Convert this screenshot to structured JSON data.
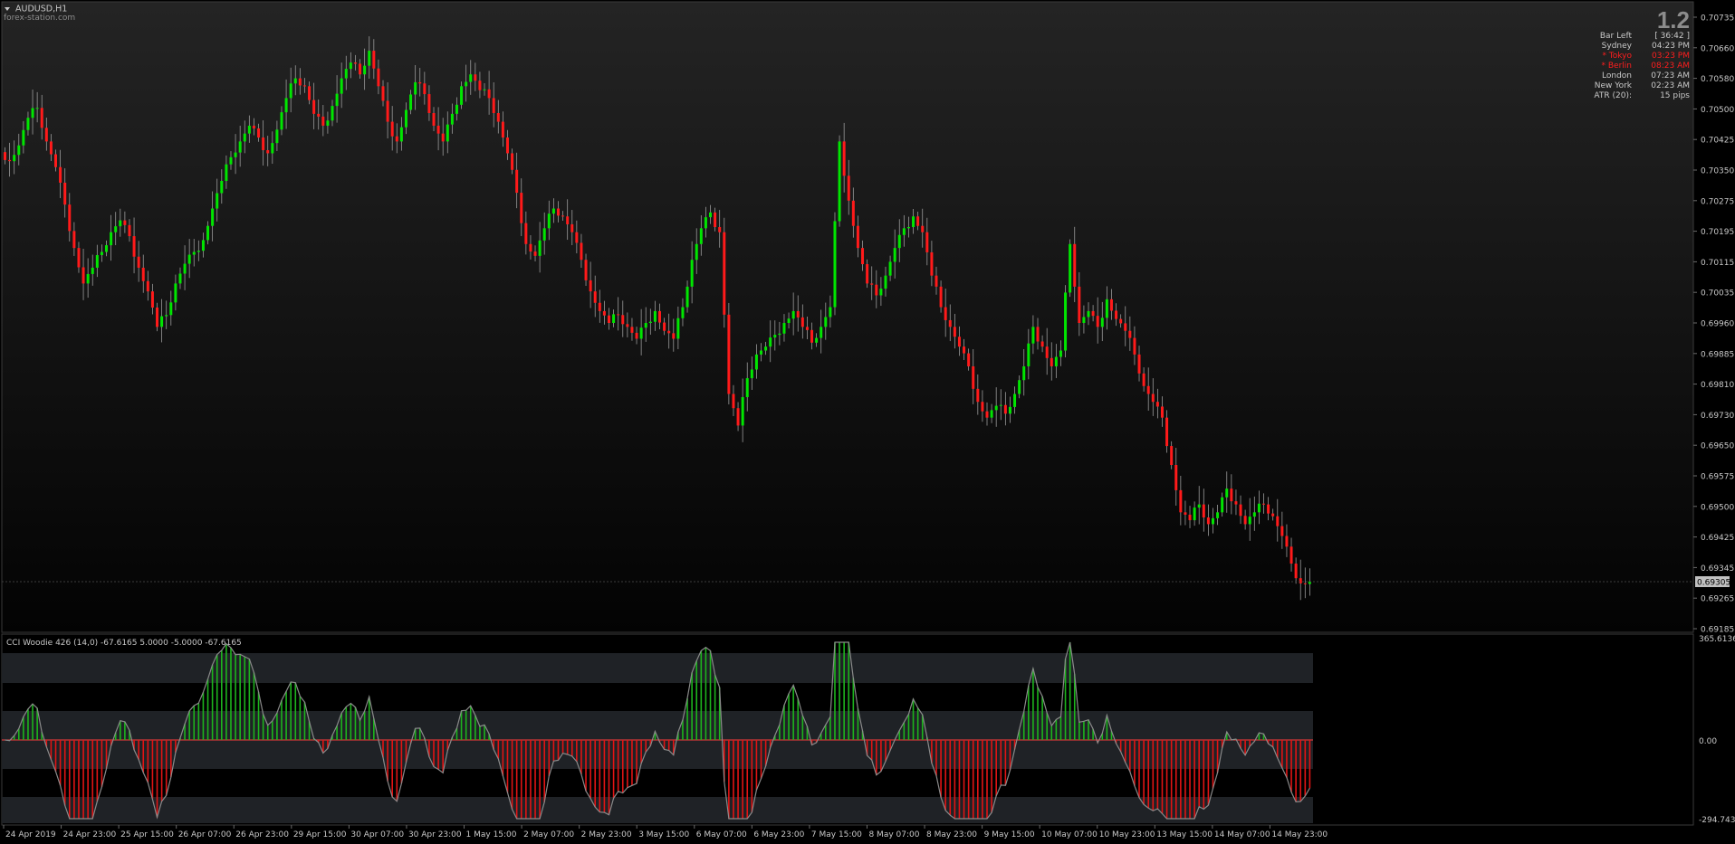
{
  "window": {
    "symbol_title": "AUDUSD,H1",
    "watermark": "forex-station.com"
  },
  "info_panel": {
    "version": "1.2",
    "rows": [
      {
        "label": "Bar Left",
        "value": "[ 36:42 ]",
        "color": "#c8c8c8"
      },
      {
        "label": "Sydney",
        "value": "04:23 PM",
        "color": "#c8c8c8"
      },
      {
        "label": "* Tokyo",
        "value": "03:23 PM",
        "color": "#ff1e1e"
      },
      {
        "label": "* Berlin",
        "value": "08:23 AM",
        "color": "#ff1e1e"
      },
      {
        "label": "London",
        "value": "07:23 AM",
        "color": "#c8c8c8"
      },
      {
        "label": "New York",
        "value": "02:23 AM",
        "color": "#c8c8c8"
      },
      {
        "label": "ATR (20):",
        "value": "15 pips",
        "color": "#c8c8c8"
      }
    ]
  },
  "price_axis": {
    "ticks": [
      "0.70735",
      "0.70660",
      "0.70580",
      "0.70500",
      "0.70425",
      "0.70350",
      "0.70275",
      "0.70195",
      "0.70115",
      "0.70035",
      "0.69960",
      "0.69885",
      "0.69810",
      "0.69730",
      "0.69650",
      "0.69575",
      "0.69500",
      "0.69425",
      "0.69345",
      "0.69265",
      "0.69185"
    ],
    "current_price": "0.69305"
  },
  "indicator": {
    "title": "CCI Woodie 426 (14,0) -67.6165 5.0000 -5.0000 -67.6165",
    "axis_labels": [
      "365.6136",
      "0.00",
      "-294.7435"
    ]
  },
  "time_axis": {
    "labels": [
      "24 Apr 2019",
      "24 Apr 23:00",
      "25 Apr 15:00",
      "26 Apr 07:00",
      "26 Apr 23:00",
      "29 Apr 15:00",
      "30 Apr 07:00",
      "30 Apr 23:00",
      "1 May 15:00",
      "2 May 07:00",
      "2 May 23:00",
      "3 May 15:00",
      "6 May 07:00",
      "6 May 23:00",
      "7 May 15:00",
      "8 May 07:00",
      "8 May 23:00",
      "9 May 15:00",
      "10 May 07:00",
      "10 May 23:00",
      "13 May 15:00",
      "14 May 07:00",
      "14 May 23:00"
    ]
  },
  "chart_data": {
    "type": "candlestick",
    "symbol": "AUDUSD,H1",
    "ylim": [
      0.69185,
      0.70735
    ],
    "bull_color": "#00e600",
    "bear_color": "#ff1a1a",
    "closes": [
      0.7037,
      0.7041,
      0.7048,
      0.70505,
      0.7042,
      0.70355,
      0.7026,
      0.7015,
      0.7006,
      0.701,
      0.7014,
      0.7019,
      0.7022,
      0.7018,
      0.701,
      0.7004,
      0.6995,
      0.6998,
      0.7006,
      0.7011,
      0.7014,
      0.7017,
      0.7025,
      0.7032,
      0.7038,
      0.7042,
      0.7046,
      0.7043,
      0.7039,
      0.7045,
      0.7053,
      0.7058,
      0.7056,
      0.7049,
      0.7046,
      0.7051,
      0.7058,
      0.7062,
      0.7059,
      0.7065,
      0.7056,
      0.7047,
      0.7042,
      0.705,
      0.7057,
      0.7054,
      0.7046,
      0.7042,
      0.7049,
      0.7056,
      0.7059,
      0.7055,
      0.7053,
      0.7047,
      0.7039,
      0.7029,
      0.7016,
      0.7013,
      0.702,
      0.7025,
      0.7023,
      0.7019,
      0.7012,
      0.7004,
      0.6999,
      0.6996,
      0.6998,
      0.6995,
      0.6992,
      0.6996,
      0.6999,
      0.6994,
      0.6992,
      0.7,
      0.7012,
      0.702,
      0.7024,
      0.7019,
      0.6978,
      0.697,
      0.6982,
      0.6988,
      0.699,
      0.6993,
      0.6996,
      0.6999,
      0.6995,
      0.6991,
      0.6995,
      0.7,
      0.7042,
      0.7027,
      0.7015,
      0.7006,
      0.7003,
      0.7008,
      0.7015,
      0.702,
      0.7023,
      0.7019,
      0.7008,
      0.7,
      0.6995,
      0.699,
      0.6985,
      0.6976,
      0.6972,
      0.6975,
      0.6973,
      0.6978,
      0.6985,
      0.6995,
      0.699,
      0.6985,
      0.6989,
      0.7016,
      0.6996,
      0.6999,
      0.6995,
      0.7002,
      0.6997,
      0.6994,
      0.6988,
      0.698,
      0.6976,
      0.6972,
      0.696,
      0.6948,
      0.6946,
      0.695,
      0.6945,
      0.6948,
      0.6954,
      0.695,
      0.6945,
      0.6948,
      0.695,
      0.6947,
      0.6942,
      0.6935,
      0.693,
      0.69305
    ]
  }
}
